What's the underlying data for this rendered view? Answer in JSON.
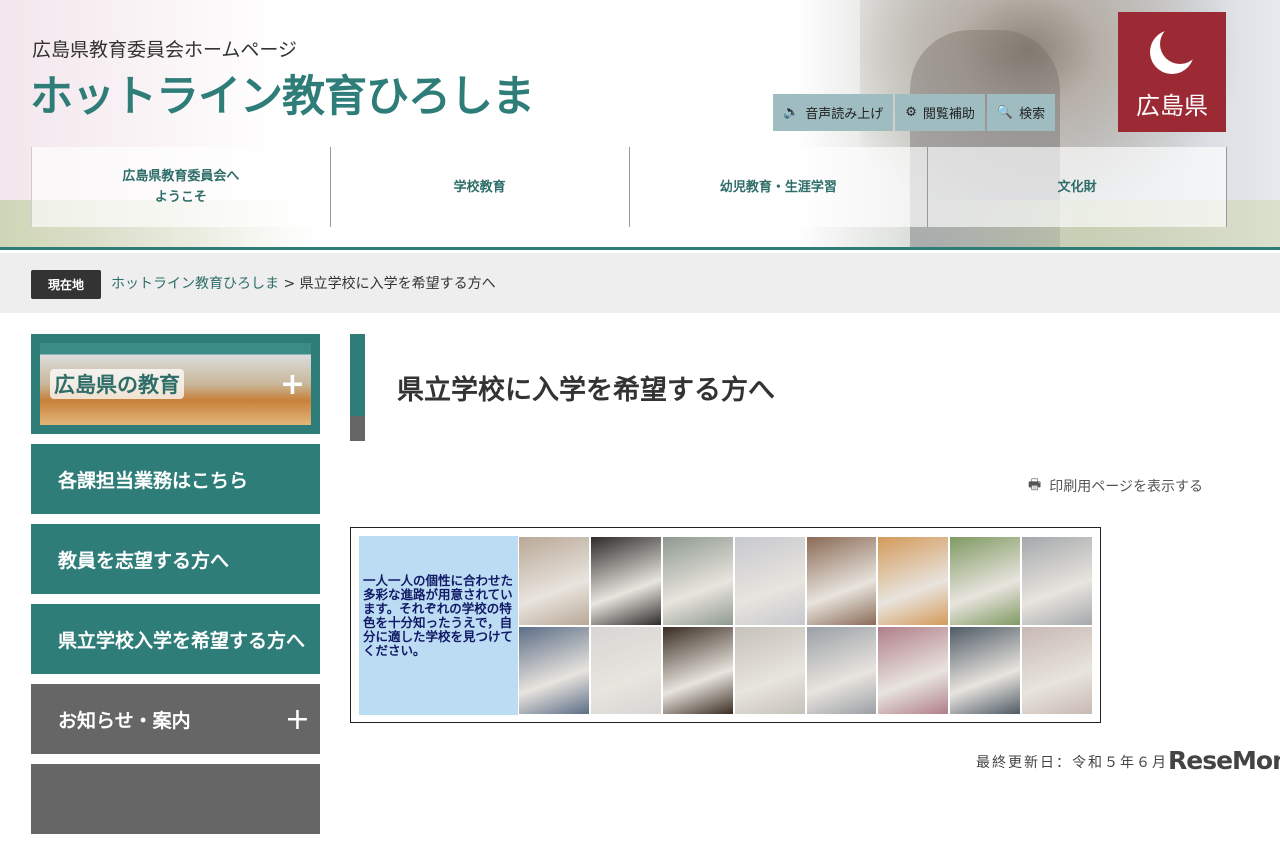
{
  "header": {
    "subtitle": "広島県教育委員会ホームページ",
    "logo": "ホットライン教育ひろしま",
    "tools": [
      {
        "icon": "speaker-icon",
        "glyph": "🔈",
        "label": "音声読み上げ"
      },
      {
        "icon": "gear-icon",
        "glyph": "⚙",
        "label": "閲覧補助"
      },
      {
        "icon": "search-icon",
        "glyph": "🔍",
        "label": "検索"
      }
    ],
    "pref_logo": "広島県",
    "nav": [
      {
        "line1": "広島県教育委員会へ",
        "line2": "ようこそ"
      },
      {
        "line1": "学校教育",
        "line2": ""
      },
      {
        "line1": "幼児教育・生涯学習",
        "line2": ""
      },
      {
        "line1": "文化財",
        "line2": ""
      }
    ]
  },
  "breadcrumb": {
    "label": "現在地",
    "home": "ホットライン教育ひろしま",
    "sep": ">",
    "current": "県立学校に入学を希望する方へ"
  },
  "sidebar": {
    "edu": "広島県の教育",
    "items": [
      "各課担当業務はこちら",
      "教員を志望する方へ",
      "県立学校入学を希望する方へ"
    ],
    "notice": "お知らせ・案内",
    "plus": "+"
  },
  "main": {
    "title": "県立学校に入学を希望する方へ",
    "print": "印刷用ページを表示する",
    "banner_text": "一人一人の個性に合わせた多彩な進路が用意されています。それぞれの学校の特色を十分知ったうえで，自分に適した学校を見つけてください。",
    "photo_colors": [
      "#b9a896",
      "#2d2a2a",
      "#8e9a8f",
      "#c7c9cf",
      "#8a6a55",
      "#d49a5a",
      "#7f9a62",
      "#a4a8ab",
      "#5b6d86",
      "#d8d6d4",
      "#3a2d22",
      "#c5c2ba",
      "#9aa0a6",
      "#b07f8a",
      "#4f5b66",
      "#c8b8b2"
    ],
    "updated": "最終更新日：令和５年６月"
  },
  "watermark": "ReseMom"
}
